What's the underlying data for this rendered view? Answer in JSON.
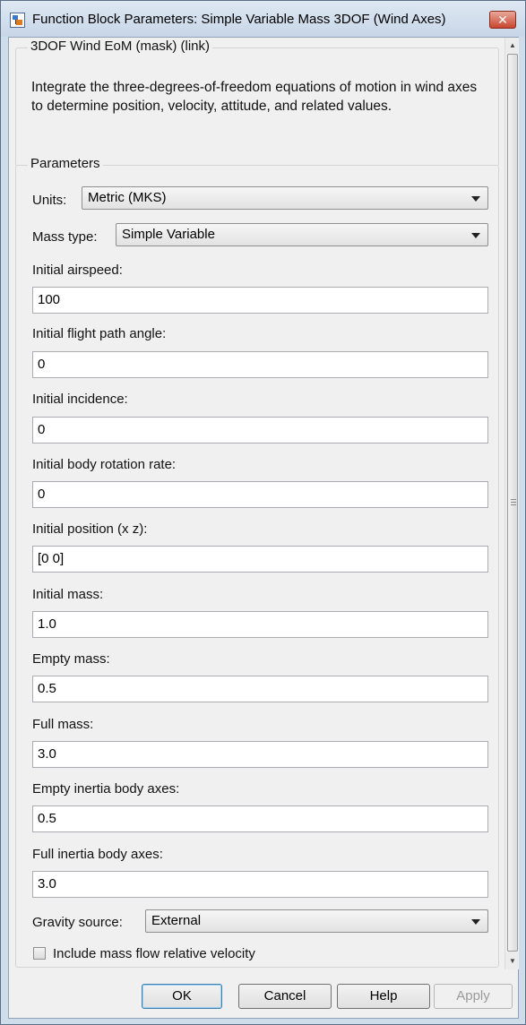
{
  "window": {
    "title": "Function Block Parameters: Simple Variable Mass 3DOF (Wind Axes)",
    "close_glyph": "✕"
  },
  "description_group": {
    "legend": "3DOF Wind EoM (mask) (link)",
    "text": "Integrate the three-degrees-of-freedom equations of motion in wind axes to determine position, velocity, attitude, and related values."
  },
  "parameters": {
    "legend": "Parameters",
    "units": {
      "label": "Units:",
      "value": "Metric (MKS)"
    },
    "mass_type": {
      "label": "Mass type:",
      "value": "Simple Variable"
    },
    "fields": [
      {
        "label": "Initial airspeed:",
        "value": "100"
      },
      {
        "label": "Initial flight path angle:",
        "value": "0"
      },
      {
        "label": "Initial incidence:",
        "value": "0"
      },
      {
        "label": "Initial body rotation rate:",
        "value": "0"
      },
      {
        "label": "Initial position (x z):",
        "value": "[0 0]"
      },
      {
        "label": "Initial mass:",
        "value": "1.0"
      },
      {
        "label": "Empty mass:",
        "value": "0.5"
      },
      {
        "label": "Full mass:",
        "value": "3.0"
      },
      {
        "label": "Empty inertia body axes:",
        "value": "0.5"
      },
      {
        "label": "Full inertia body axes:",
        "value": "3.0"
      }
    ],
    "gravity_source": {
      "label": "Gravity source:",
      "value": "External"
    },
    "include_mass_flow": {
      "label": "Include mass flow relative velocity",
      "checked": false
    }
  },
  "buttons": {
    "ok": "OK",
    "cancel": "Cancel",
    "help": "Help",
    "apply": "Apply"
  },
  "icons": {
    "app": "simulink-block-icon",
    "dropdown": "chevron-down-icon",
    "scroll_up": "scroll-up-arrow-icon",
    "scroll_down": "scroll-down-arrow-icon"
  },
  "colors": {
    "title_bar": "#c7d6e8",
    "close_button": "#c8452e",
    "dialog_bg": "#f0f0f0"
  }
}
